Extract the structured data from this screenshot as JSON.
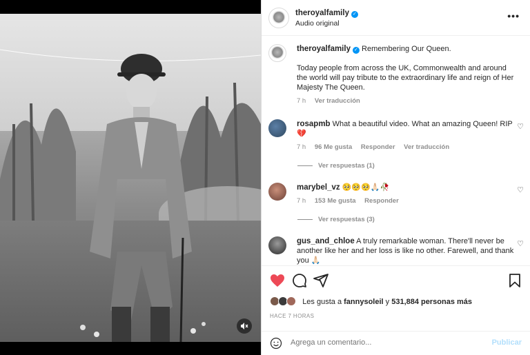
{
  "post": {
    "author": "theroyalfamily",
    "audio": "Audio original",
    "more_label": "•••"
  },
  "caption": {
    "author": "theroyalfamily",
    "headline": "Remembering Our Queen.",
    "text": "Today people from across the UK, Commonwealth and around the world will pay tribute to the extraordinary life and reign of Her Majesty The Queen.",
    "time": "7 h",
    "translate": "Ver traducción"
  },
  "comments": [
    {
      "user": "rosapmb",
      "text": "What a beautiful video. What an amazing Queen! RIP 💔",
      "time": "7 h",
      "likes": "96 Me gusta",
      "reply": "Responder",
      "translate": "Ver traducción",
      "replies": "Ver respuestas (1)"
    },
    {
      "user": "marybel_vz",
      "text": "🥺🥺🥺🙏🏻🥀",
      "time": "7 h",
      "likes": "153 Me gusta",
      "reply": "Responder",
      "replies": "Ver respuestas (3)"
    },
    {
      "user": "gus_and_chloe",
      "text": "A truly remarkable woman. There'll never be another like her and her loss is like no other. Farewell, and thank you 🙏🏻"
    }
  ],
  "likes": {
    "prefix": "Les gusta a",
    "user": "fannysoleil",
    "joiner": "y",
    "count": "531,884 personas más"
  },
  "time_ago": "HACE 7 HORAS",
  "composer": {
    "placeholder": "Agrega un comentario...",
    "post_label": "Publicar"
  },
  "colors": {
    "like_red": "#ed4956",
    "verified_blue": "#0095f6",
    "post_disabled": "#b2dffc"
  }
}
